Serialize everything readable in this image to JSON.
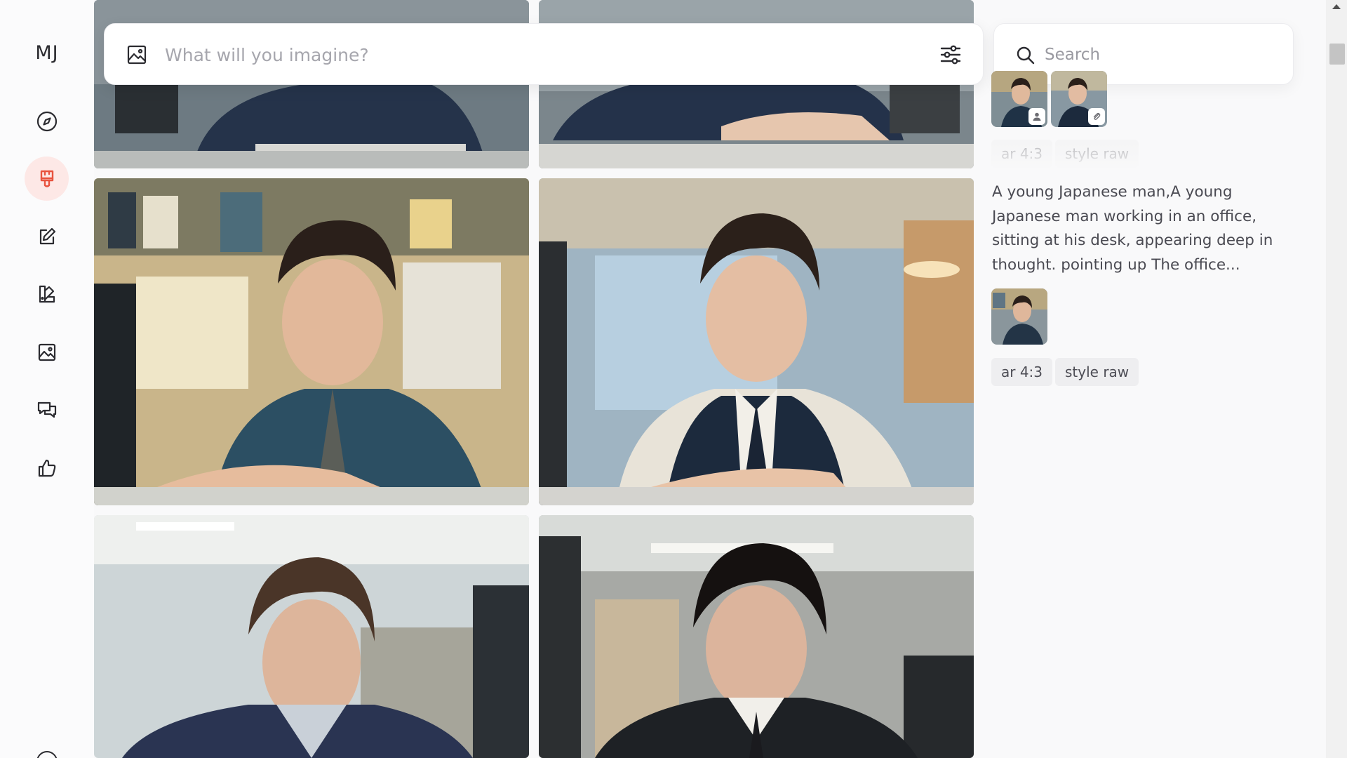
{
  "app": {
    "logo_text": "MJ"
  },
  "sidebar": {
    "items": [
      {
        "name": "explore",
        "icon": "compass-icon"
      },
      {
        "name": "create",
        "icon": "paintbrush-icon",
        "active": true,
        "accent": "#e8533f"
      },
      {
        "name": "edit",
        "icon": "pencil-square-icon"
      },
      {
        "name": "personalize",
        "icon": "palette-icon"
      },
      {
        "name": "organize",
        "icon": "image-icon"
      },
      {
        "name": "chat",
        "icon": "chat-bubbles-icon"
      },
      {
        "name": "tasks",
        "icon": "thumbs-up-icon"
      }
    ]
  },
  "prompt_bar": {
    "placeholder": "What will you imagine?",
    "value": "",
    "left_icon": "image-icon",
    "right_icon": "sliders-icon"
  },
  "search": {
    "placeholder": "Search",
    "value": "",
    "icon": "search-icon"
  },
  "info_panel": {
    "top_group": {
      "thumbnails": [
        {
          "badge_icon": "person-icon"
        },
        {
          "badge_icon": "paperclip-icon"
        }
      ],
      "tags": [
        "ar 4:3",
        "style raw"
      ]
    },
    "current_group": {
      "prompt": "A young Japanese man,A young Japanese man working in an office, sitting at his desk, appearing deep in thought. pointing up The office...",
      "thumbnails": [
        {
          "badge_icon": null
        }
      ],
      "tags": [
        "ar 4:3",
        "style raw"
      ]
    }
  },
  "grid": {
    "images": [
      {
        "id": "top-left",
        "subject": "office worker at desk (partial)"
      },
      {
        "id": "top-right",
        "subject": "office worker at desk (partial)"
      },
      {
        "id": "mid-left",
        "subject": "young man in blue shirt and tie at office desk"
      },
      {
        "id": "mid-right",
        "subject": "young man in white shirt and navy vest at office desk"
      },
      {
        "id": "bottom-left",
        "subject": "young man in office (partial)"
      },
      {
        "id": "bottom-right",
        "subject": "young man in dark suit in office (partial)"
      }
    ]
  },
  "colors": {
    "accent": "#e8533f",
    "accent_bg": "#fde8e6",
    "tag_bg": "#eeeef0",
    "page_bg": "#f9f9fa"
  }
}
